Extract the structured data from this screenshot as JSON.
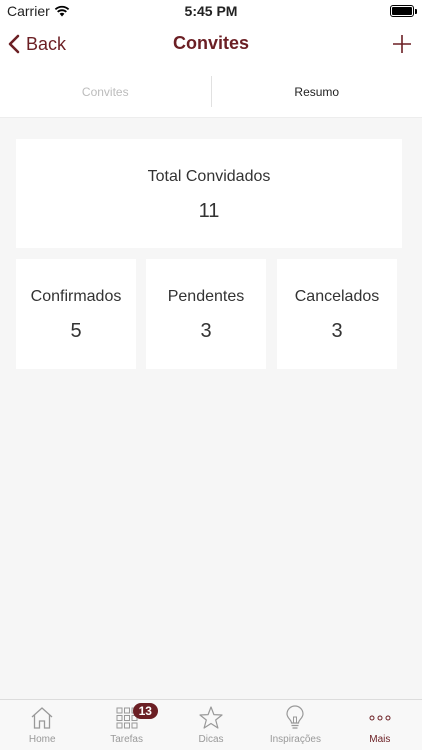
{
  "status_bar": {
    "carrier": "Carrier",
    "time": "5:45 PM"
  },
  "nav": {
    "back_label": "Back",
    "title": "Convites"
  },
  "segments": [
    {
      "label": "Convites",
      "active": false
    },
    {
      "label": "Resumo",
      "active": true
    }
  ],
  "summary": {
    "total": {
      "label": "Total Convidados",
      "value": "11"
    },
    "confirmed": {
      "label": "Confirmados",
      "value": "5"
    },
    "pending": {
      "label": "Pendentes",
      "value": "3"
    },
    "cancelled": {
      "label": "Cancelados",
      "value": "3"
    }
  },
  "tab_bar": {
    "items": [
      {
        "label": "Home",
        "icon": "home-icon"
      },
      {
        "label": "Tarefas",
        "icon": "grid-icon",
        "badge": "13"
      },
      {
        "label": "Dicas",
        "icon": "star-icon"
      },
      {
        "label": "Inspirações",
        "icon": "lightbulb-icon"
      },
      {
        "label": "Mais",
        "icon": "more-icon",
        "active": true
      }
    ]
  },
  "colors": {
    "accent": "#6b1f24",
    "background": "#f6f6f6"
  }
}
